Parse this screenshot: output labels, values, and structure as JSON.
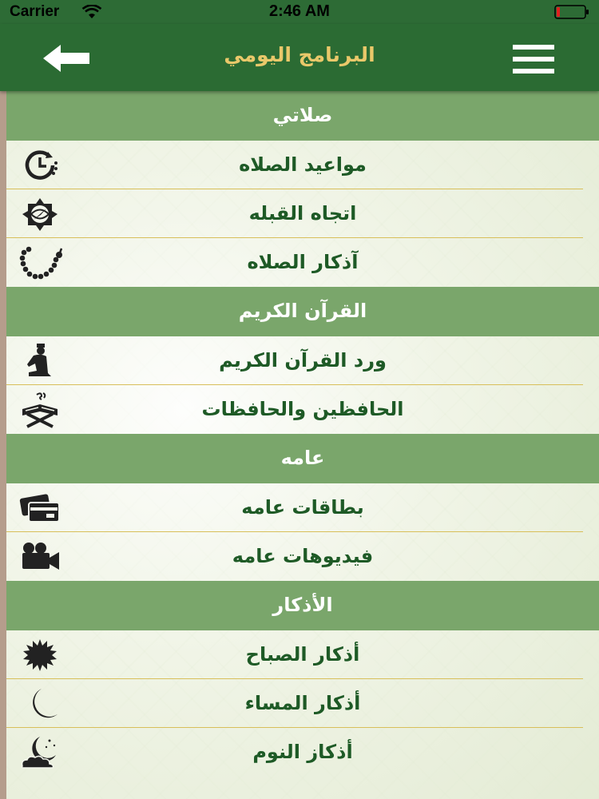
{
  "status_bar": {
    "carrier": "Carrier",
    "time": "2:46 AM",
    "battery_state": "low",
    "battery_color": "#e02020"
  },
  "nav_bar": {
    "title": "البرنامج اليومي",
    "back_icon": "arrow-left-icon",
    "menu_icon": "hamburger-menu-icon",
    "background_color": "#2b6b33",
    "title_color": "#e9c86a"
  },
  "sections": [
    {
      "title": "صلاتي",
      "items": [
        {
          "label": "مواعيد الصلاه",
          "icon": "clock-icon"
        },
        {
          "label": "اتجاه القبله",
          "icon": "compass-icon"
        },
        {
          "label": "آذكار الصلاه",
          "icon": "prayer-beads-icon"
        }
      ]
    },
    {
      "title": "القرآن الكريم",
      "items": [
        {
          "label": "ورد القرآن الكريم",
          "icon": "praying-person-icon"
        },
        {
          "label": "الحافظين والحافظات",
          "icon": "quran-stand-icon"
        }
      ]
    },
    {
      "title": "عامه",
      "items": [
        {
          "label": "بطاقات عامه",
          "icon": "cards-icon"
        },
        {
          "label": "فيديوهات عامه",
          "icon": "video-camera-icon"
        }
      ]
    },
    {
      "title": "الأذكار",
      "items": [
        {
          "label": "أذكار الصباح",
          "icon": "sun-icon"
        },
        {
          "label": "أذكار المساء",
          "icon": "crescent-moon-icon"
        },
        {
          "label": "أذكاز النوم",
          "icon": "night-cloud-icon"
        }
      ]
    }
  ],
  "colors": {
    "section_header_bg": "#7aa66b",
    "item_text": "#1e5a26",
    "divider": "#d8bf5a"
  }
}
